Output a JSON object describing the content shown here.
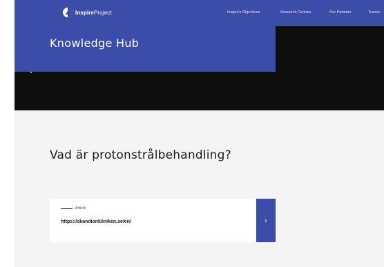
{
  "nav": {
    "logo_bold": "Inspire",
    "logo_regular": "Project",
    "links": [
      "Inspire's Objectives",
      "Research Centres",
      "Our Partners",
      "Transn"
    ]
  },
  "hero": {
    "title": "Knowledge Hub"
  },
  "section": {
    "title": "Vad är protonstrålbehandling?"
  },
  "card": {
    "kicker": "Article",
    "url": "https://skandionkliniken.se/en/",
    "arrow": "›"
  },
  "colors": {
    "brand": "#3c4ca9",
    "dark": "#0e0e0e",
    "section_bg": "#f4f4f4"
  }
}
